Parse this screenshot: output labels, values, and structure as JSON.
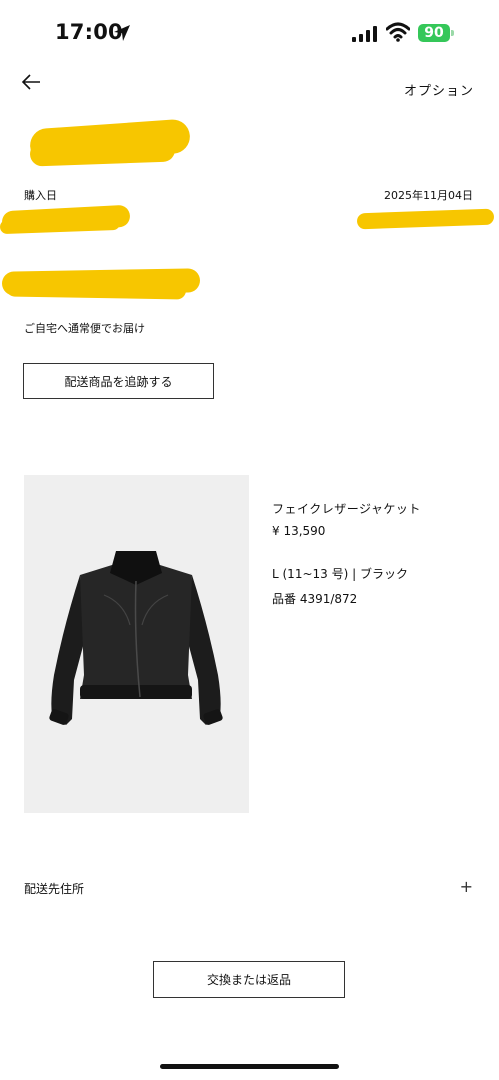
{
  "status_bar": {
    "time": "17:00",
    "battery": "90"
  },
  "header": {
    "options_label": "オプション"
  },
  "order": {
    "purchase_date_label": "購入日",
    "purchase_date": "2025年11月04日",
    "delivery_method": "ご自宅へ通常便でお届け",
    "track_button": "配送商品を追跡する"
  },
  "product": {
    "name": "フェイクレザージャケット",
    "price": "¥ 13,590",
    "variant": "L (11~13 号) | ブラック",
    "ref": "品番 4391/872"
  },
  "shipping_address_label": "配送先住所",
  "shipping_address_toggle": "+",
  "return_button": "交換または返品",
  "colors": {
    "battery": "#35c759",
    "redaction": "#f7c600"
  }
}
